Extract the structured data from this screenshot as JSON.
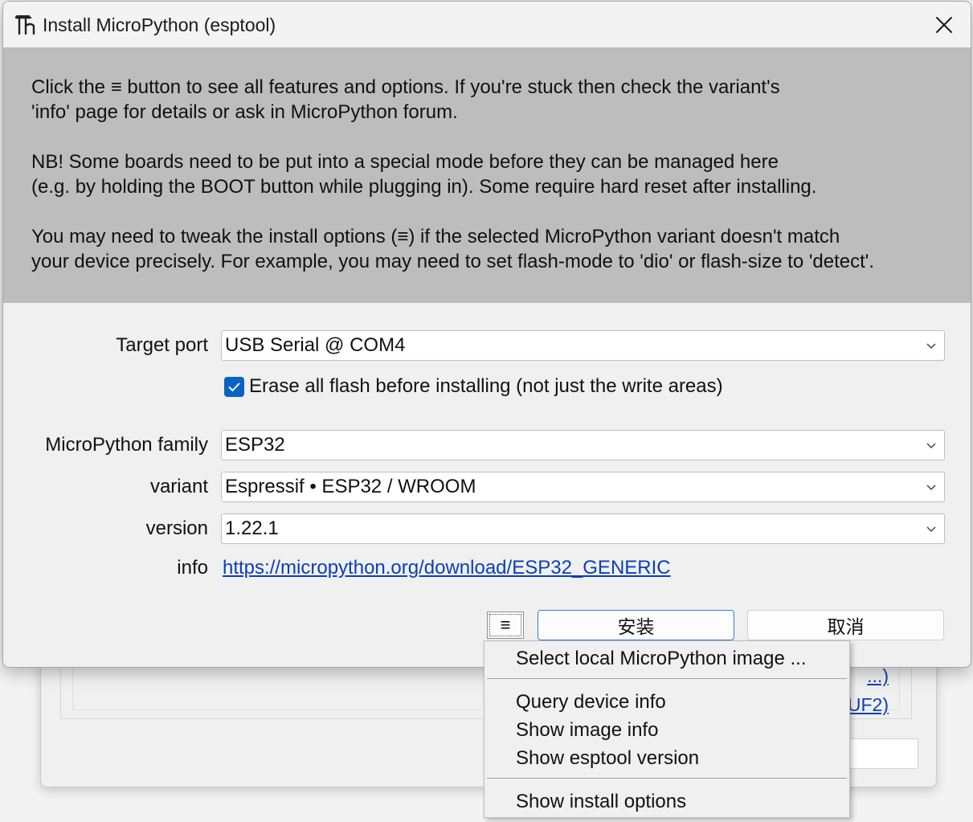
{
  "window": {
    "title": "Install MicroPython (esptool)",
    "close_glyph": "✕"
  },
  "intro": {
    "paragraph1": "Click the ≡ button to see all features and options. If you're stuck then check the variant's\n'info' page for details or ask in MicroPython forum.",
    "paragraph2": "NB! Some boards need to be put into a special mode before they can be managed here\n(e.g. by holding the BOOT button while plugging in). Some require hard reset after installing.",
    "paragraph3": "You may need to tweak the install options (≡) if the selected MicroPython variant doesn't match\nyour device precisely. For example, you may need to set flash-mode to 'dio' or flash-size to 'detect'."
  },
  "form": {
    "target_port": {
      "label": "Target port",
      "value": "USB Serial @ COM4"
    },
    "erase_flash": {
      "label": "Erase all flash before installing (not just the write areas)",
      "checked": true
    },
    "family": {
      "label": "MicroPython family",
      "value": "ESP32"
    },
    "variant": {
      "label": "variant",
      "value": "Espressif • ESP32 / WROOM"
    },
    "version": {
      "label": "version",
      "value": "1.22.1"
    },
    "info": {
      "label": "info",
      "link": "https://micropython.org/download/ESP32_GENERIC"
    }
  },
  "buttons": {
    "menu": "≡",
    "install": "安装",
    "cancel": "取消"
  },
  "menu": {
    "items": [
      "Select local MicroPython image ...",
      "Query device info",
      "Show image info",
      "Show esptool version",
      "Show install options"
    ]
  },
  "background_window": {
    "link1": "...)",
    "link2": "UF2)"
  },
  "colors": {
    "accent": "#0a63c4",
    "link": "#0b3fb5",
    "intro_bg": "#bdbdbd"
  }
}
